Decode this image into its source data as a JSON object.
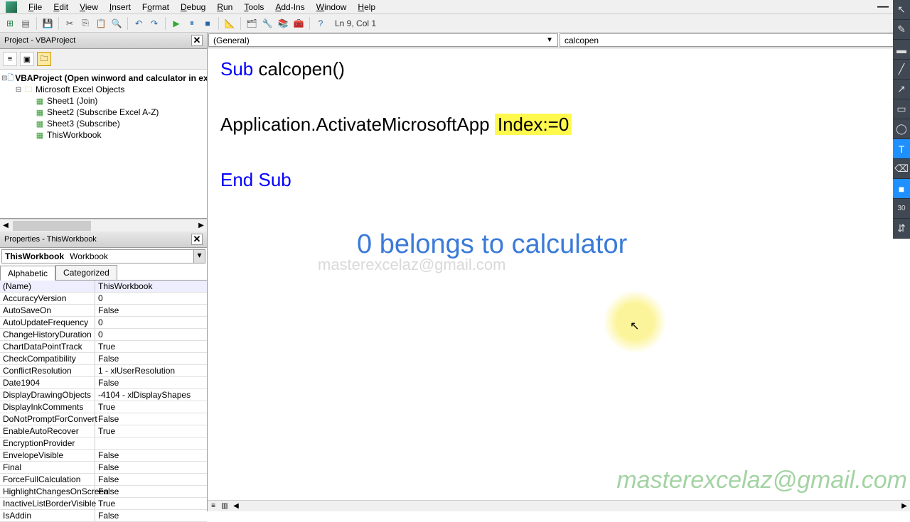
{
  "menu": {
    "file": "File",
    "edit": "Edit",
    "view": "View",
    "insert": "Insert",
    "format": "Format",
    "debug": "Debug",
    "run": "Run",
    "tools": "Tools",
    "addins": "Add-Ins",
    "window": "Window",
    "help": "Help"
  },
  "toolbar": {
    "cursor_pos": "Ln 9, Col 1"
  },
  "project_pane": {
    "title": "Project - VBAProject",
    "root": "VBAProject (Open winword and calculator in ex",
    "folder": "Microsoft Excel Objects",
    "items": [
      "Sheet1 (Join)",
      "Sheet2 (Subscribe Excel A-Z)",
      "Sheet3 (Subscribe)",
      "ThisWorkbook"
    ]
  },
  "props_pane": {
    "title": "Properties - ThisWorkbook",
    "combo_bold": "ThisWorkbook",
    "combo_normal": "Workbook",
    "tabs": {
      "alpha": "Alphabetic",
      "cat": "Categorized"
    },
    "rows": [
      {
        "n": "(Name)",
        "v": "ThisWorkbook"
      },
      {
        "n": "AccuracyVersion",
        "v": "0"
      },
      {
        "n": "AutoSaveOn",
        "v": "False"
      },
      {
        "n": "AutoUpdateFrequency",
        "v": "0"
      },
      {
        "n": "ChangeHistoryDuration",
        "v": "0"
      },
      {
        "n": "ChartDataPointTrack",
        "v": "True"
      },
      {
        "n": "CheckCompatibility",
        "v": "False"
      },
      {
        "n": "ConflictResolution",
        "v": "1 - xlUserResolution"
      },
      {
        "n": "Date1904",
        "v": "False"
      },
      {
        "n": "DisplayDrawingObjects",
        "v": "-4104 - xlDisplayShapes"
      },
      {
        "n": "DisplayInkComments",
        "v": "True"
      },
      {
        "n": "DoNotPromptForConvert",
        "v": "False"
      },
      {
        "n": "EnableAutoRecover",
        "v": "True"
      },
      {
        "n": "EncryptionProvider",
        "v": ""
      },
      {
        "n": "EnvelopeVisible",
        "v": "False"
      },
      {
        "n": "Final",
        "v": "False"
      },
      {
        "n": "ForceFullCalculation",
        "v": "False"
      },
      {
        "n": "HighlightChangesOnScreen",
        "v": "False"
      },
      {
        "n": "InactiveListBorderVisible",
        "v": "True"
      },
      {
        "n": "IsAddin",
        "v": "False"
      }
    ]
  },
  "code": {
    "combo_left": "(General)",
    "combo_right": "calcopen",
    "line1_a": "Sub ",
    "line1_b": "calcopen()",
    "line2_a": "Application.ActivateMicrosoftApp ",
    "line2_hl": "Index:=0",
    "line3": "End Sub",
    "annotation": "0 belongs to calculator",
    "watermark_faint": "masterexcelaz@gmail.com",
    "watermark_green": "masterexcelaz@gmail.com"
  },
  "right_toolbar": {
    "num": "30"
  }
}
